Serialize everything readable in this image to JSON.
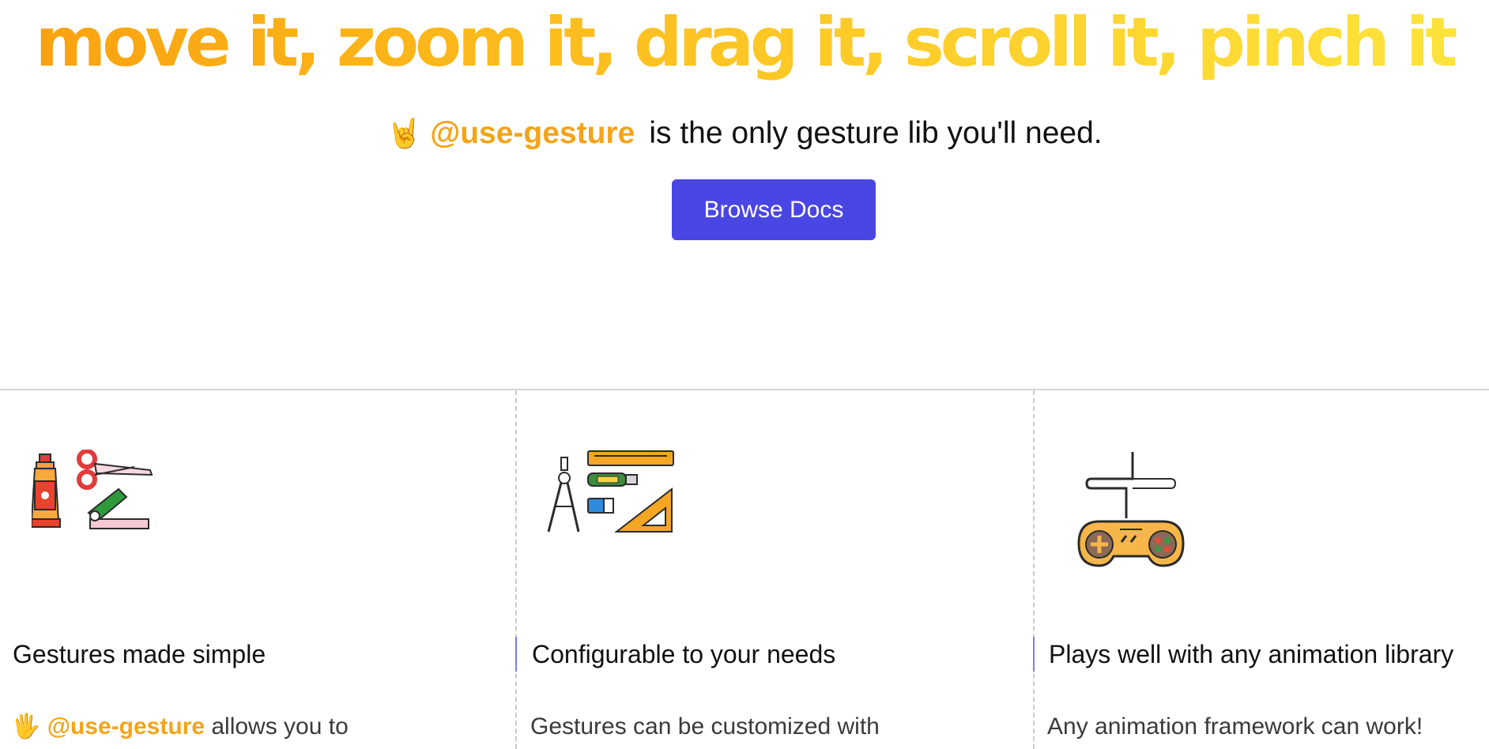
{
  "hero": {
    "headline": "move it, zoom it, drag it, scroll it, pinch it",
    "tagline_emoji": "🤘",
    "tagline_brand": "@use-gesture",
    "tagline_rest": "is the only gesture lib you'll need.",
    "cta_label": "Browse Docs"
  },
  "colors": {
    "brand": "#f4a419",
    "cta": "#4a46e3",
    "headline_gradient": [
      "#f9a010",
      "#fde43c"
    ]
  },
  "features": [
    {
      "icon": "craft-tools-icon",
      "title": "Gestures made simple",
      "desc_emoji": "🖐",
      "desc_brand": "@use-gesture",
      "desc_rest": "allows you to"
    },
    {
      "icon": "drafting-tools-icon",
      "title": "Configurable to your needs",
      "desc": "Gestures can be customized with"
    },
    {
      "icon": "gamepad-icon",
      "title": "Plays well with any animation library",
      "desc": "Any animation framework can work!"
    }
  ]
}
